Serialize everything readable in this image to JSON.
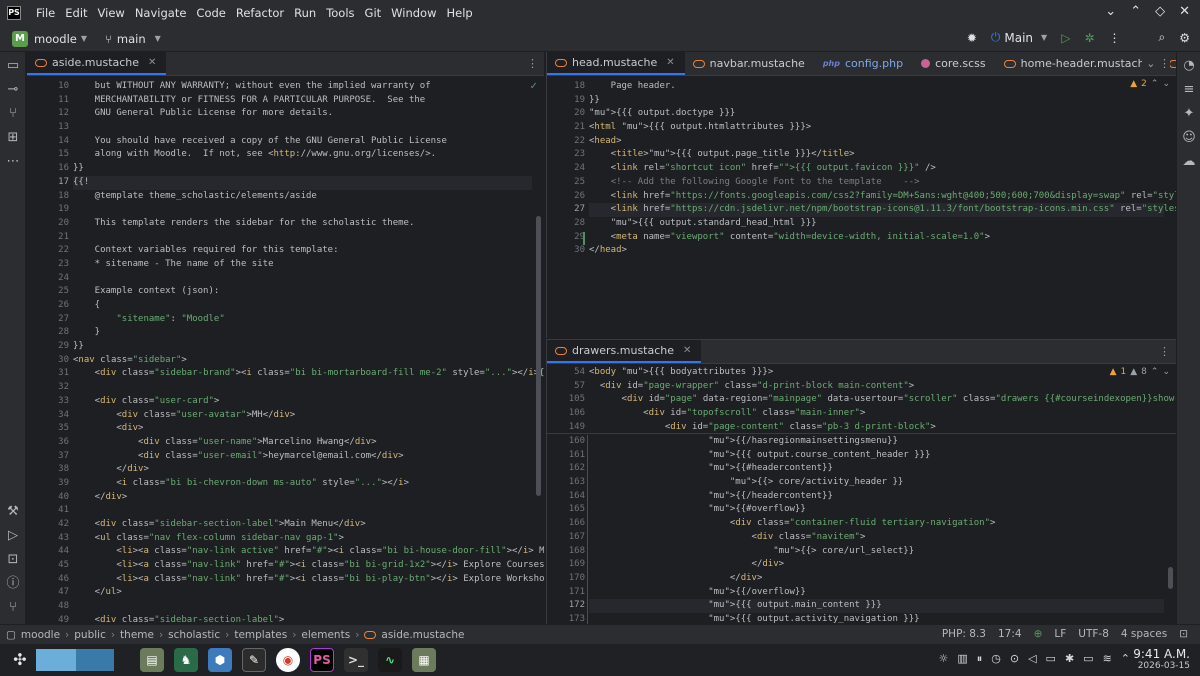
{
  "menu": [
    "File",
    "Edit",
    "View",
    "Navigate",
    "Code",
    "Refactor",
    "Run",
    "Tools",
    "Git",
    "Window",
    "Help"
  ],
  "project": {
    "badge": "M",
    "name": "moodle",
    "branch": "main"
  },
  "run_config": "Main",
  "left_pane": {
    "tab": "aside.mustache",
    "lines": [
      {
        "n": "10",
        "html": "    but WITHOUT ANY WARRANTY; without even the implied warranty of"
      },
      {
        "n": "11",
        "html": "    MERCHANTABILITY or FITNESS FOR A PARTICULAR PURPOSE.  See the"
      },
      {
        "n": "12",
        "html": "    GNU General Public License for more details."
      },
      {
        "n": "13",
        "html": ""
      },
      {
        "n": "14",
        "html": "    You should have received a copy of the GNU General Public License"
      },
      {
        "n": "15",
        "html": "    along with Moodle.  If not, see <http://www.gnu.org/licenses/>."
      },
      {
        "n": "16",
        "html": "}}"
      },
      {
        "n": "17",
        "html": "{{!",
        "cur": true
      },
      {
        "n": "18",
        "html": "    @template theme_scholastic/elements/aside"
      },
      {
        "n": "19",
        "html": ""
      },
      {
        "n": "20",
        "html": "    This template renders the sidebar for the scholastic theme."
      },
      {
        "n": "21",
        "html": ""
      },
      {
        "n": "22",
        "html": "    Context variables required for this template:"
      },
      {
        "n": "23",
        "html": "    * sitename - The name of the site"
      },
      {
        "n": "24",
        "html": ""
      },
      {
        "n": "25",
        "html": "    Example context (json):"
      },
      {
        "n": "26",
        "html": "    {"
      },
      {
        "n": "27",
        "html": "        \"sitename\": \"Moodle\""
      },
      {
        "n": "28",
        "html": "    }"
      },
      {
        "n": "29",
        "html": "}}"
      },
      {
        "n": "30",
        "html": "<nav class=\"sidebar\">"
      },
      {
        "n": "31",
        "html": "    <div class=\"sidebar-brand\"><i class=\"bi bi-mortarboard-fill me-2\" style=\"...\"></i>{{sitename"
      },
      {
        "n": "32",
        "html": ""
      },
      {
        "n": "33",
        "html": "    <div class=\"user-card\">"
      },
      {
        "n": "34",
        "html": "        <div class=\"user-avatar\">MH</div>"
      },
      {
        "n": "35",
        "html": "        <div>"
      },
      {
        "n": "36",
        "html": "            <div class=\"user-name\">Marcelino Hwang</div>"
      },
      {
        "n": "37",
        "html": "            <div class=\"user-email\">heymarcel@email.com</div>"
      },
      {
        "n": "38",
        "html": "        </div>"
      },
      {
        "n": "39",
        "html": "        <i class=\"bi bi-chevron-down ms-auto\" style=\"...\"></i>"
      },
      {
        "n": "40",
        "html": "    </div>"
      },
      {
        "n": "41",
        "html": ""
      },
      {
        "n": "42",
        "html": "    <div class=\"sidebar-section-label\">Main Menu</div>"
      },
      {
        "n": "43",
        "html": "    <ul class=\"nav flex-column sidebar-nav gap-1\">"
      },
      {
        "n": "44",
        "html": "        <li><a class=\"nav-link active\" href=\"#\"><i class=\"bi bi-house-door-fill\"></i> My Progres"
      },
      {
        "n": "45",
        "html": "        <li><a class=\"nav-link\" href=\"#\"><i class=\"bi bi-grid-1x2\"></i> Explore Courses</a></li"
      },
      {
        "n": "46",
        "html": "        <li><a class=\"nav-link\" href=\"#\"><i class=\"bi bi-play-btn\"></i> Explore Workshops</a></"
      },
      {
        "n": "47",
        "html": "    </ul>"
      },
      {
        "n": "48",
        "html": ""
      },
      {
        "n": "49",
        "html": "    <div class=\"sidebar-section-label\">"
      }
    ]
  },
  "head_pane": {
    "tabs": [
      "head.mustache",
      "navbar.mustache",
      "config.php",
      "core.scss",
      "home-header.mustache",
      "announceme"
    ],
    "inspections": "2",
    "lines": [
      {
        "n": "18",
        "html": "    Page header."
      },
      {
        "n": "19",
        "html": "}}"
      },
      {
        "n": "20",
        "html": "{{{ output.doctype }}}"
      },
      {
        "n": "21",
        "html": "<html {{{ output.htmlattributes }}}>"
      },
      {
        "n": "22",
        "html": "<head>"
      },
      {
        "n": "23",
        "html": "    <title>{{{ output.page_title }}}</title>"
      },
      {
        "n": "24",
        "html": "    <link rel=\"shortcut icon\" href=\"{{{ output.favicon }}}\" />"
      },
      {
        "n": "25",
        "html": "    <!-- Add the following Google Font to the template    -->"
      },
      {
        "n": "26",
        "html": "    <link href=\"https://fonts.googleapis.com/css2?family=DM+Sans:wght@400;500;600;700&display=swap\" rel=\"stylesheet\"/>"
      },
      {
        "n": "27",
        "html": "    <link href=\"https://cdn.jsdelivr.net/npm/bootstrap-icons@1.11.3/font/bootstrap-icons.min.css\" rel=\"stylesheet\"/>",
        "cur": true
      },
      {
        "n": "28",
        "html": "    {{{ output.standard_head_html }}}"
      },
      {
        "n": "29",
        "html": "    <meta name=\"viewport\" content=\"width=device-width, initial-scale=1.0\">"
      },
      {
        "n": "30",
        "html": "</head>"
      }
    ]
  },
  "drawers_pane": {
    "tab": "drawers.mustache",
    "inspections": "1",
    "inspections2": "8",
    "sticky": [
      {
        "n": "54",
        "html": "<body {{{ bodyattributes }}}>"
      },
      {
        "n": "57",
        "html": "  <div id=\"page-wrapper\" class=\"d-print-block main-content\">"
      },
      {
        "n": "105",
        "html": "      <div id=\"page\" data-region=\"mainpage\" data-usertour=\"scroller\" class=\"drawers {{#courseindexopen}}show-drawer-lef"
      },
      {
        "n": "106",
        "html": "          <div id=\"topofscroll\" class=\"main-inner\">"
      },
      {
        "n": "149",
        "html": "              <div id=\"page-content\" class=\"pb-3 d-print-block\">"
      }
    ],
    "lines": [
      {
        "n": "160",
        "html": "                      {{/hasregionmainsettingsmenu}}"
      },
      {
        "n": "161",
        "html": "                      {{{ output.course_content_header }}}"
      },
      {
        "n": "162",
        "html": "                      {{#headercontent}}"
      },
      {
        "n": "163",
        "html": "                          {{> core/activity_header }}"
      },
      {
        "n": "164",
        "html": "                      {{/headercontent}}"
      },
      {
        "n": "165",
        "html": "                      {{#overflow}}"
      },
      {
        "n": "166",
        "html": "                          <div class=\"container-fluid tertiary-navigation\">"
      },
      {
        "n": "167",
        "html": "                              <div class=\"navitem\">"
      },
      {
        "n": "168",
        "html": "                                  {{> core/url_select}}"
      },
      {
        "n": "169",
        "html": "                              </div>"
      },
      {
        "n": "170",
        "html": "                          </div>"
      },
      {
        "n": "171",
        "html": "                      {{/overflow}}"
      },
      {
        "n": "172",
        "html": "                      {{{ output.main_content }}}",
        "cur": true
      },
      {
        "n": "173",
        "html": "                      {{{ output.activity_navigation }}}"
      }
    ]
  },
  "breadcrumbs": [
    "moodle",
    "public",
    "theme",
    "scholastic",
    "templates",
    "elements",
    "aside.mustache"
  ],
  "status": {
    "php": "PHP: 8.3",
    "pos": "17:4",
    "lf": "LF",
    "enc": "UTF-8",
    "indent": "4 spaces"
  },
  "clock": {
    "time": "9:41 A.M.",
    "date": "2026-03-15"
  }
}
